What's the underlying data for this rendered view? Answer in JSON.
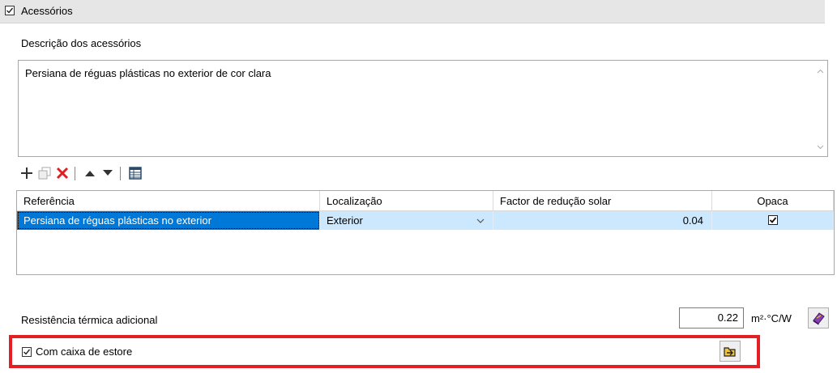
{
  "group": {
    "title": "Acessórios",
    "checked": true
  },
  "description": {
    "label": "Descrição dos acessórios",
    "value": "Persiana de réguas plásticas no exterior de cor clara"
  },
  "toolbar": {
    "icons": [
      "add-icon",
      "duplicate-icon",
      "delete-icon",
      "move-up-icon",
      "move-down-icon",
      "table-icon"
    ]
  },
  "table": {
    "headers": [
      "Referência",
      "Localização",
      "Factor de redução solar",
      "Opaca"
    ],
    "rows": [
      {
        "reference": "Persiana de réguas plásticas no exterior",
        "location": "Exterior",
        "factor": "0.04",
        "opaque": true
      }
    ]
  },
  "resistance": {
    "label": "Resistência térmica adicional",
    "value": "0.22",
    "unit": "m²·°C/W"
  },
  "box": {
    "label": "Com caixa de estore",
    "checked": true
  },
  "colors": {
    "highlight": "#e31e24",
    "selection": "#cce8ff"
  }
}
